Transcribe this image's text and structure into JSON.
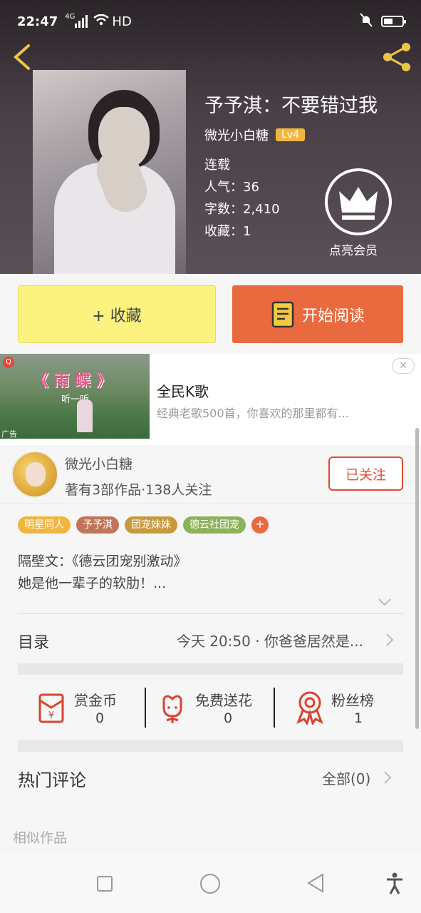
{
  "status_bar": {
    "time": "22:47",
    "network": "4G",
    "hd": "HD",
    "icons": [
      "signal-icon",
      "wifi-icon",
      "mute-icon",
      "battery-icon"
    ]
  },
  "header": {
    "back_icon": "chevron-left-icon",
    "share_icon": "share-icon"
  },
  "book": {
    "title": "予予淇：不要错过我",
    "author": "微光小白糖",
    "level": "Lv4",
    "status": "连载",
    "popularity": "人气：36",
    "word_count": "字数：2,410",
    "favorites": "收藏：1",
    "vip_label": "点亮会员"
  },
  "actions": {
    "collect_label": "+ 收藏",
    "read_label": "开始阅读"
  },
  "ad": {
    "image_title": "《 雨 蝶 》",
    "image_sub": "听一听",
    "ad_tag": "广告",
    "title": "全民K歌",
    "description": "经典老歌500首，你喜欢的那里都有...",
    "close_label": "✕"
  },
  "author_card": {
    "name": "微光小白糖",
    "stats": "著有3部作品·138人关注",
    "follow_label": "已关注"
  },
  "tags": [
    {
      "label": "明星同人",
      "color": "#f1b640"
    },
    {
      "label": "予予淇",
      "color": "#c0745a"
    },
    {
      "label": "团宠妹妹",
      "color": "#c79a3e"
    },
    {
      "label": "德云社团宠",
      "color": "#8bb35a"
    }
  ],
  "tag_more": "+",
  "description": {
    "line1": "隔壁文：《德云团宠别激动》",
    "line2": "她是他一辈子的软肋！..."
  },
  "toc": {
    "label": "目录",
    "latest": "今天 20:50 · 你爸爸居然是..."
  },
  "rewards": [
    {
      "title": "赏金币",
      "count": "0",
      "icon": "red-envelope-icon"
    },
    {
      "title": "免费送花",
      "count": "0",
      "icon": "flower-icon"
    },
    {
      "title": "粉丝榜",
      "count": "1",
      "icon": "medal-icon"
    }
  ],
  "comments": {
    "title": "热门评论",
    "all_label": "全部(0)"
  },
  "similar": {
    "title": "相似作品"
  },
  "colors": {
    "accent_orange": "#ea6a40",
    "collect_yellow": "#fbf280",
    "follow_red": "#e04c35",
    "share_gold": "#e9c54a"
  }
}
